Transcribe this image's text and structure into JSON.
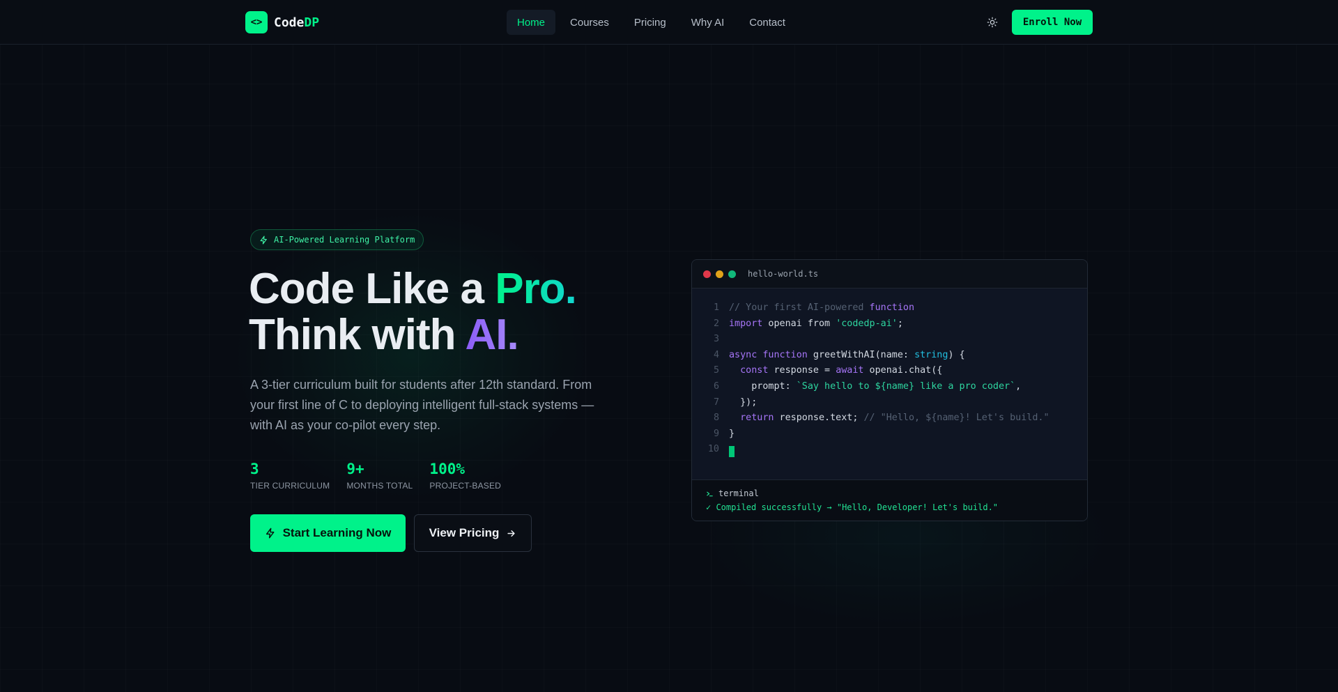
{
  "nav": {
    "logo_icon_text": "<>",
    "logo_text_main": "Code",
    "logo_text_accent": "DP",
    "links": [
      {
        "label": "Home",
        "active": true
      },
      {
        "label": "Courses",
        "active": false
      },
      {
        "label": "Pricing",
        "active": false
      },
      {
        "label": "Why AI",
        "active": false
      },
      {
        "label": "Contact",
        "active": false
      }
    ],
    "theme_icon": "sun-icon",
    "enroll_label": "Enroll Now"
  },
  "hero": {
    "badge_icon": "bolt-icon",
    "badge_text": "AI-Powered Learning Platform",
    "headline_line1_prefix": "Code Like a ",
    "headline_line1_accent": "Pro.",
    "headline_line2_prefix": "Think with ",
    "headline_line2_accent": "AI.",
    "description": "A 3-tier curriculum built for students after 12th standard. From your first line of C to deploying intelligent full-stack systems — with AI as your co-pilot every step.",
    "stats": [
      {
        "value": "3",
        "label": "TIER CURRICULUM"
      },
      {
        "value": "9+",
        "label": "MONTHS TOTAL"
      },
      {
        "value": "100%",
        "label": "PROJECT-BASED"
      }
    ],
    "cta_primary": "Start Learning Now",
    "cta_secondary": "View Pricing"
  },
  "code_window": {
    "filename": "hello-world.ts",
    "dots": [
      "#e0384a",
      "#e0a21a",
      "#11b87a"
    ],
    "lines": [
      {
        "n": "1",
        "tokens": [
          {
            "t": "// Your first AI-powered ",
            "c": "cm"
          },
          {
            "t": "function",
            "c": "kw"
          }
        ]
      },
      {
        "n": "2",
        "tokens": [
          {
            "t": "import",
            "c": "kw"
          },
          {
            "t": " openai from ",
            "c": "plain"
          },
          {
            "t": "'codedp-ai'",
            "c": "str"
          },
          {
            "t": ";",
            "c": "plain"
          }
        ]
      },
      {
        "n": "3",
        "tokens": []
      },
      {
        "n": "4",
        "tokens": [
          {
            "t": "async function",
            "c": "kw"
          },
          {
            "t": " greetWithAI(name: ",
            "c": "plain"
          },
          {
            "t": "string",
            "c": "ty"
          },
          {
            "t": ") {",
            "c": "plain"
          }
        ]
      },
      {
        "n": "5",
        "tokens": [
          {
            "t": "  ",
            "c": "plain"
          },
          {
            "t": "const",
            "c": "kw"
          },
          {
            "t": " response = ",
            "c": "plain"
          },
          {
            "t": "await",
            "c": "kw"
          },
          {
            "t": " openai.chat({",
            "c": "plain"
          }
        ]
      },
      {
        "n": "6",
        "tokens": [
          {
            "t": "    prompt: ",
            "c": "plain"
          },
          {
            "t": "`Say hello to ${name} like a pro coder`",
            "c": "str"
          },
          {
            "t": ",",
            "c": "plain"
          }
        ]
      },
      {
        "n": "7",
        "tokens": [
          {
            "t": "  });",
            "c": "plain"
          }
        ]
      },
      {
        "n": "8",
        "tokens": [
          {
            "t": "  ",
            "c": "plain"
          },
          {
            "t": "return",
            "c": "kw"
          },
          {
            "t": " response.text; ",
            "c": "plain"
          },
          {
            "t": "// \"Hello, ${name}! Let's build.\"",
            "c": "cm"
          }
        ]
      },
      {
        "n": "9",
        "tokens": [
          {
            "t": "}",
            "c": "plain"
          }
        ]
      },
      {
        "n": "10",
        "tokens": [],
        "cursor": true
      }
    ],
    "terminal_label": "terminal",
    "terminal_output": "✓ Compiled successfully → \"Hello, Developer! Let's build.\""
  }
}
